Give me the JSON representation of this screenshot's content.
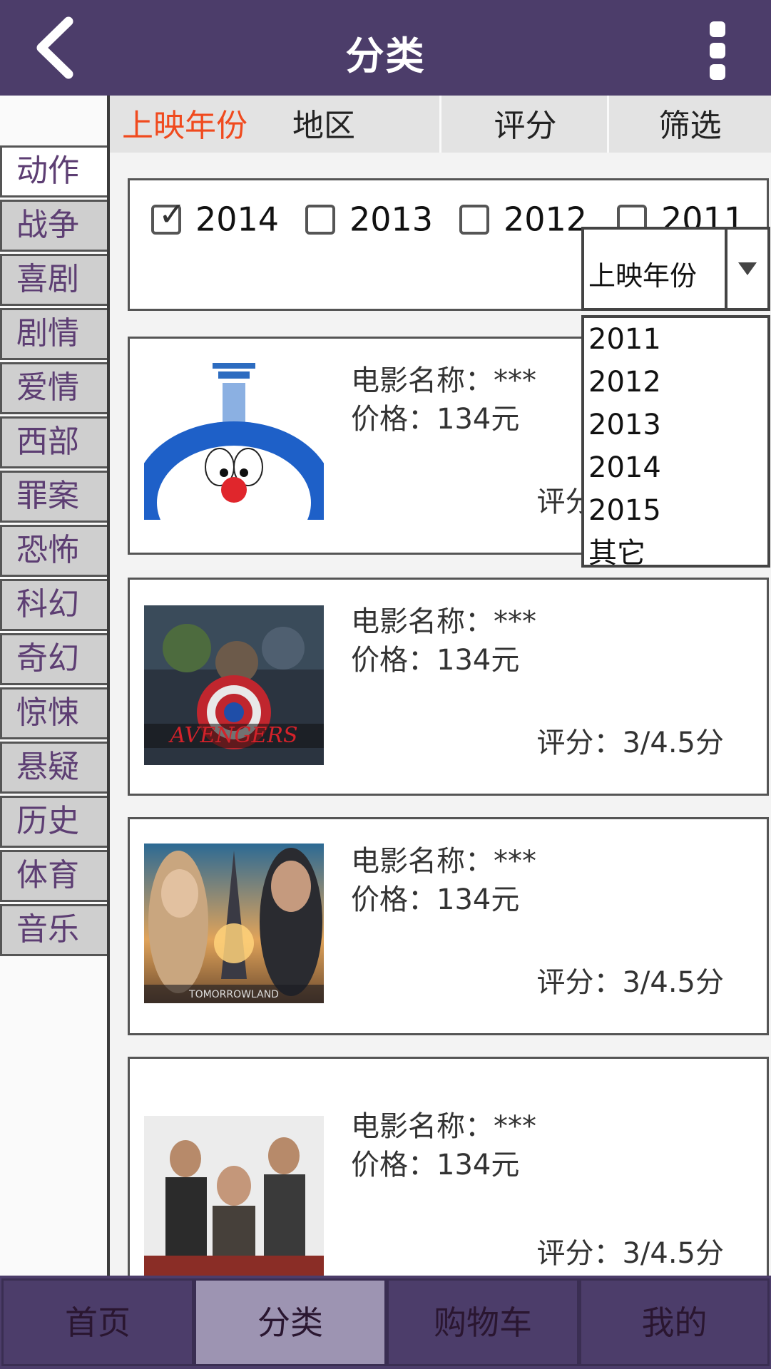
{
  "header": {
    "title": "分类"
  },
  "sidebar": {
    "categories": [
      "动作",
      "战争",
      "喜剧",
      "剧情",
      "爱情",
      "西部",
      "罪案",
      "恐怖",
      "科幻",
      "奇幻",
      "惊悚",
      "悬疑",
      "历史",
      "体育",
      "音乐"
    ],
    "active_index": 0
  },
  "tabs": [
    {
      "label": "上映年份",
      "active": true
    },
    {
      "label": "地区"
    },
    {
      "label": "评分"
    },
    {
      "label": "筛选"
    }
  ],
  "year_filter": [
    {
      "label": "2014",
      "checked": true
    },
    {
      "label": "2013",
      "checked": false
    },
    {
      "label": "2012",
      "checked": false
    },
    {
      "label": "2011",
      "checked": false
    }
  ],
  "dropdown": {
    "selected": "上映年份",
    "options": [
      "2011",
      "2012",
      "2013",
      "2014",
      "2015",
      "其它"
    ]
  },
  "movies": [
    {
      "name": "电影名称：***",
      "price": "价格：134元",
      "rating": "评分：3/4.5分",
      "poster": "doraemon-poster"
    },
    {
      "name": "电影名称：***",
      "price": "价格：134元",
      "rating": "评分：3/4.5分",
      "poster": "avengers-poster"
    },
    {
      "name": "电影名称：***",
      "price": "价格：134元",
      "rating": "评分：3/4.5分",
      "poster": "tomorrowland-poster"
    },
    {
      "name": "电影名称：***",
      "price": "价格：134元",
      "rating": "评分：3/4.5分",
      "poster": "action-movie-poster"
    }
  ],
  "bottom_nav": [
    {
      "label": "首页"
    },
    {
      "label": "分类",
      "active": true
    },
    {
      "label": "购物车"
    },
    {
      "label": "我的"
    }
  ],
  "colors": {
    "header": "#4c3d6a",
    "active_tab": "#f04a1e",
    "category_text": "#5d3e73",
    "nav_active": "#9d94b2"
  }
}
